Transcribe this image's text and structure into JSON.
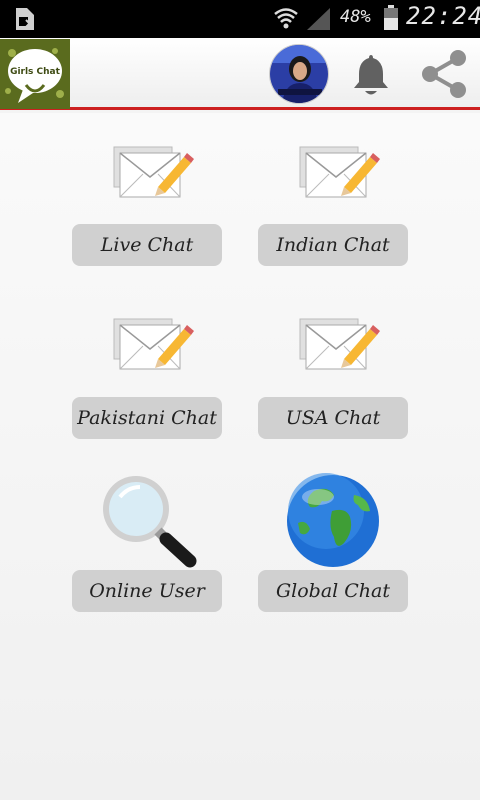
{
  "status_bar": {
    "battery_percent": "48%",
    "time": "22:24"
  },
  "app_bar": {
    "logo_text": "Girls Chat",
    "icons": [
      "avatar",
      "bell-icon",
      "share-icon"
    ]
  },
  "menu": {
    "items": [
      {
        "label": "Live Chat",
        "icon": "envelope-pencil-icon"
      },
      {
        "label": "Indian Chat",
        "icon": "envelope-pencil-icon"
      },
      {
        "label": "Pakistani Chat",
        "icon": "envelope-pencil-icon"
      },
      {
        "label": "USA Chat",
        "icon": "envelope-pencil-icon"
      },
      {
        "label": "Online User",
        "icon": "magnifier-icon"
      },
      {
        "label": "Global Chat",
        "icon": "globe-icon"
      }
    ]
  },
  "colors": {
    "accent_line": "#cc1f1f",
    "button_bg": "#d0d0d0"
  }
}
